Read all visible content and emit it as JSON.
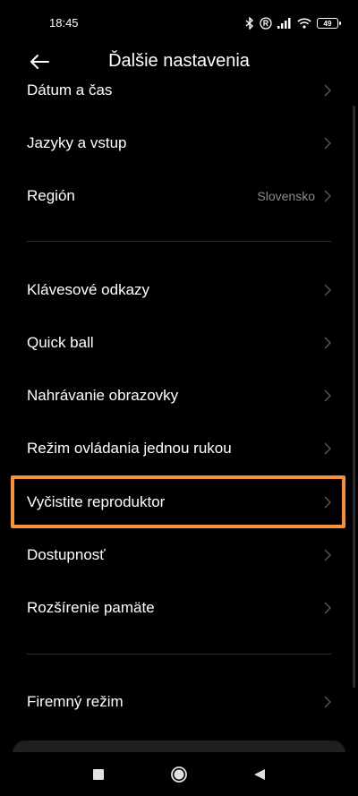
{
  "status": {
    "time": "18:45",
    "battery": "49"
  },
  "header": {
    "title": "Ďalšie nastavenia"
  },
  "items": [
    {
      "label": "Dátum a čas"
    },
    {
      "label": "Jazyky a vstup"
    },
    {
      "label": "Región",
      "value": "Slovensko"
    },
    {
      "label": "Klávesové odkazy"
    },
    {
      "label": "Quick ball"
    },
    {
      "label": "Nahrávanie obrazovky"
    },
    {
      "label": "Režim ovládania jednou rukou"
    },
    {
      "label": "Vyčistite reproduktor"
    },
    {
      "label": "Dostupnosť"
    },
    {
      "label": "Rozšírenie pamäte"
    },
    {
      "label": "Firemný režim"
    }
  ],
  "colors": {
    "highlight": "#F7923A",
    "background": "#000000"
  },
  "icons": {
    "back": "back-arrow-icon",
    "chevron": "chevron-right-icon"
  }
}
